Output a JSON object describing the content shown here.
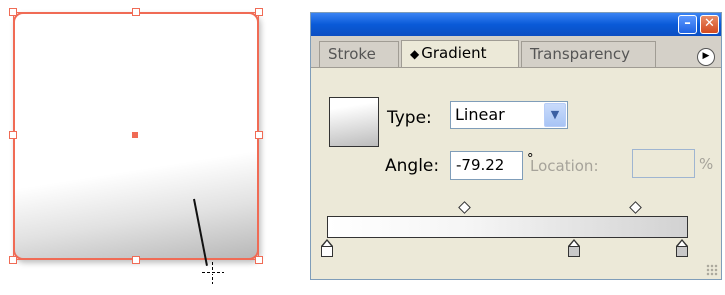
{
  "panel": {
    "tabs": [
      {
        "label": "Stroke"
      },
      {
        "label": "Gradient",
        "marker": "◆"
      },
      {
        "label": "Transparency"
      }
    ],
    "menu_icon": "panel-menu-icon",
    "minimize_glyph": "–",
    "close_glyph": "✕"
  },
  "gradient": {
    "type_label": "Type:",
    "type_value": "Linear",
    "angle_label": "Angle:",
    "angle_value": "-79.22",
    "degree_symbol": "°",
    "location_label": "Location:",
    "location_value": "",
    "percent_symbol": "%",
    "stops": [
      {
        "position": 0,
        "color": "#ffffff"
      },
      {
        "position": 69,
        "color": "#c8c8c8"
      },
      {
        "position": 100,
        "color": "#c8c8c8"
      }
    ],
    "midpoints": [
      37,
      85
    ]
  },
  "colors": {
    "selection": "#f06b55",
    "title_bar": "#0a5ad8",
    "panel_bg": "#ece9d8"
  }
}
